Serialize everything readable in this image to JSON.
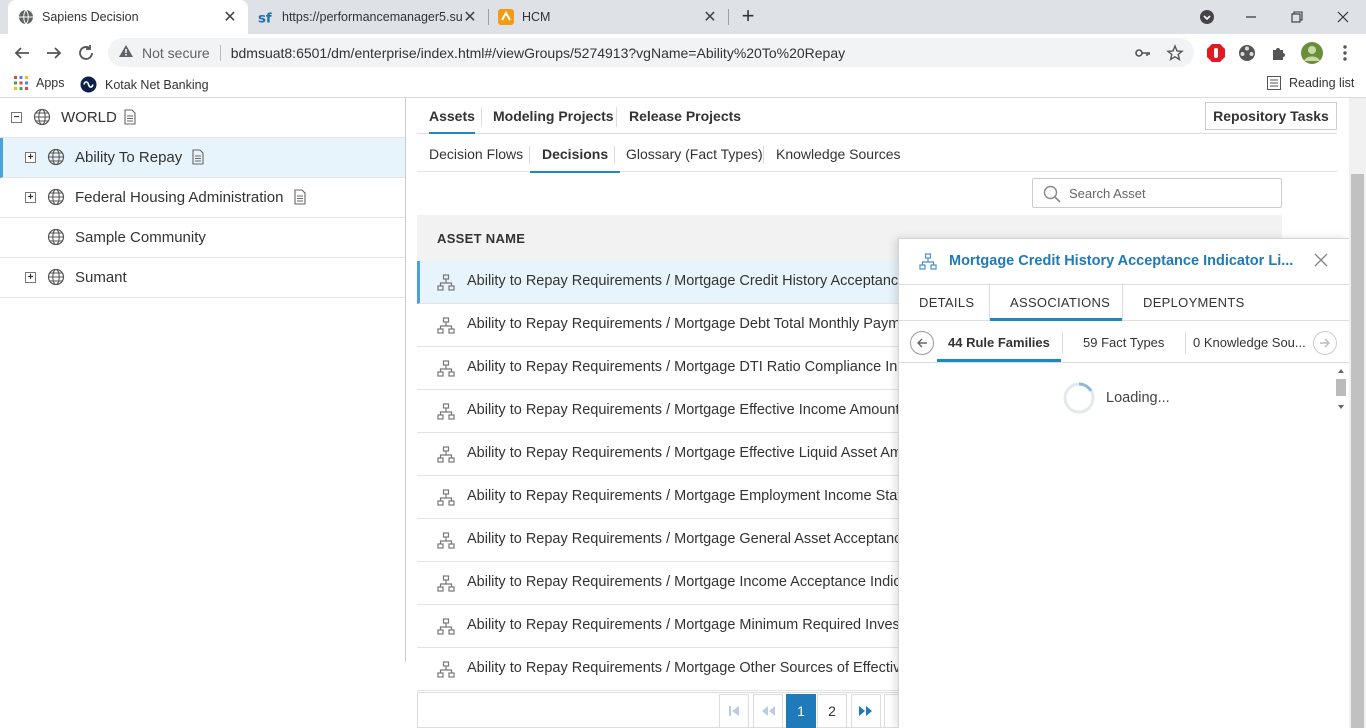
{
  "browser": {
    "tabs": [
      {
        "title": "Sapiens Decision",
        "icon": "globe-icon",
        "active": true
      },
      {
        "title": "https://performancemanager5.su",
        "icon": "sf-logo-icon",
        "active": false
      },
      {
        "title": "HCM",
        "icon": "hcm-logo-icon",
        "active": false
      }
    ],
    "new_tab": "+",
    "close_glyph": "✕",
    "security_label": "Not secure",
    "url": "bdmsuat8:6501/dm/enterprise/index.html#/viewGroups/5274913?vgName=Ability%20To%20Repay",
    "bookmarks": [
      {
        "label": "Apps",
        "icon": "apps-grid-icon"
      },
      {
        "label": "Kotak Net Banking",
        "icon": "kotak-logo-icon"
      }
    ],
    "reading_list": "Reading list"
  },
  "tree": {
    "items": [
      {
        "label": "WORLD",
        "expander": "−",
        "has_doc": true,
        "selected": false
      },
      {
        "label": "Ability To Repay",
        "expander": "+",
        "has_doc": true,
        "selected": true
      },
      {
        "label": "Federal Housing Administration",
        "expander": "+",
        "has_doc": true,
        "selected": false
      },
      {
        "label": "Sample Community",
        "expander": "",
        "has_doc": false,
        "selected": false
      },
      {
        "label": "Sumant",
        "expander": "+",
        "has_doc": false,
        "selected": false
      }
    ]
  },
  "top_tabs": [
    "Assets",
    "Modeling Projects",
    "Release Projects"
  ],
  "repository_tasks": "Repository Tasks",
  "sub_tabs": [
    "Decision Flows",
    "Decisions",
    "Glossary (Fact Types)",
    "Knowledge Sources"
  ],
  "search": {
    "placeholder": "Search Asset"
  },
  "table": {
    "header": "ASSET NAME",
    "rows": [
      "Ability to Repay Requirements / Mortgage Credit History Acceptance Indicator Li",
      "Ability to Repay Requirements / Mortgage Debt Total Monthly Payment",
      "Ability to Repay Requirements / Mortgage DTI Ratio Compliance Indicator",
      "Ability to Repay Requirements / Mortgage Effective Income Amount",
      "Ability to Repay Requirements / Mortgage Effective Liquid Asset Amount",
      "Ability to Repay Requirements / Mortgage Employment Income Status",
      "Ability to Repay Requirements / Mortgage General Asset Acceptance",
      "Ability to Repay Requirements / Mortgage Income Acceptance Indicator",
      "Ability to Repay Requirements / Mortgage Minimum Required Investment",
      "Ability to Repay Requirements / Mortgage Other Sources of Effective Income"
    ]
  },
  "pager": {
    "pages": [
      "1",
      "2"
    ],
    "current": "1"
  },
  "panel": {
    "title": "Mortgage Credit History Acceptance Indicator Li...",
    "tabs": [
      "DETAILS",
      "ASSOCIATIONS",
      "DEPLOYMENTS"
    ],
    "active_tab": "ASSOCIATIONS",
    "subtabs": [
      "44 Rule Families",
      "59 Fact Types",
      "0 Knowledge Sou..."
    ],
    "loading": "Loading..."
  },
  "colors": {
    "accent": "#1e88c7",
    "link": "#1e7ab8",
    "selected_bg": "#e7f4fb"
  }
}
